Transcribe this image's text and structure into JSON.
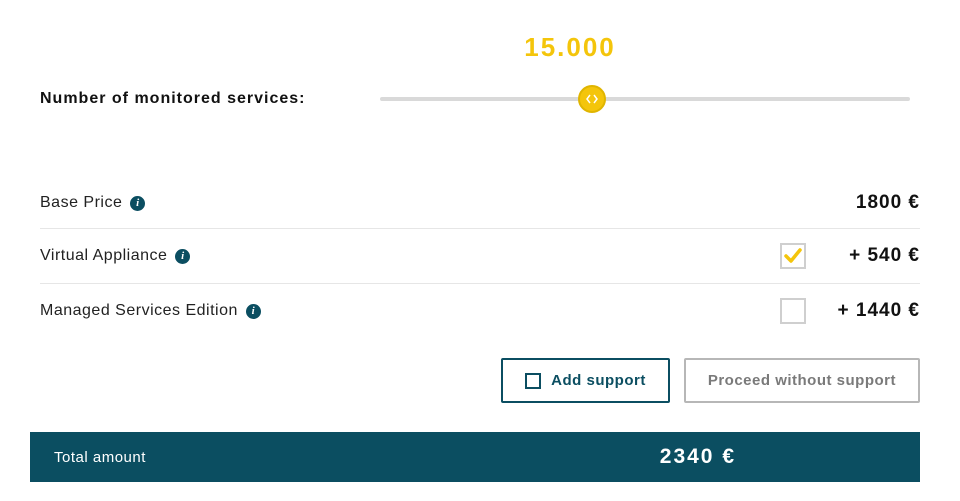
{
  "slider": {
    "label": "Number of monitored services:",
    "value_display": "15.000"
  },
  "rows": {
    "base": {
      "label": "Base Price",
      "price": "1800 €"
    },
    "virtual": {
      "label": "Virtual Appliance",
      "price": "+ 540 €",
      "checked": true
    },
    "managed": {
      "label": "Managed Services Edition",
      "price": "+ 1440 €",
      "checked": false
    }
  },
  "actions": {
    "add_support": "Add support",
    "proceed": "Proceed without support"
  },
  "total": {
    "label": "Total amount",
    "value": "2340 €"
  }
}
